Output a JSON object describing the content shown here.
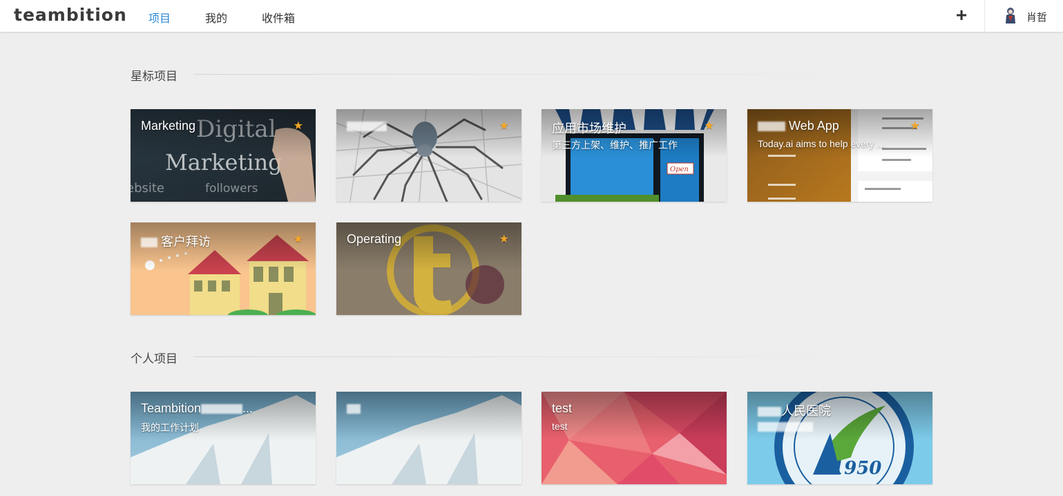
{
  "app": {
    "logo": "teambition"
  },
  "nav": {
    "items": [
      {
        "label": "项目",
        "active": true
      },
      {
        "label": "我的",
        "active": false
      },
      {
        "label": "收件箱",
        "active": false
      }
    ]
  },
  "header": {
    "add_icon": "+",
    "user_name": "肖哲"
  },
  "starred": {
    "title": "星标项目",
    "cards": [
      {
        "title": "Marketing",
        "desc": "",
        "star": "★"
      },
      {
        "title": "",
        "desc": "",
        "star": "★"
      },
      {
        "title": "应用市场维护",
        "desc": "第三方上架、维护、推广工作",
        "star": "★"
      },
      {
        "title": "Web App",
        "desc": "Today.ai aims to help every ...",
        "star": "★"
      },
      {
        "title": "客户拜访",
        "desc": "",
        "star": "★"
      },
      {
        "title": "Operating",
        "desc": "",
        "star": "★"
      }
    ]
  },
  "personal": {
    "title": "个人项目",
    "cards": [
      {
        "title": "Teambition",
        "title_suffix": "...",
        "desc": "我的工作计划"
      },
      {
        "title": "",
        "desc": ""
      },
      {
        "title": "test",
        "desc": "test"
      },
      {
        "title": "人民医院",
        "desc": "",
        "badge": "1950"
      }
    ]
  },
  "colors": {
    "accent": "#2c88d3",
    "star": "#f5a623",
    "page_bg": "#eeeeee"
  }
}
